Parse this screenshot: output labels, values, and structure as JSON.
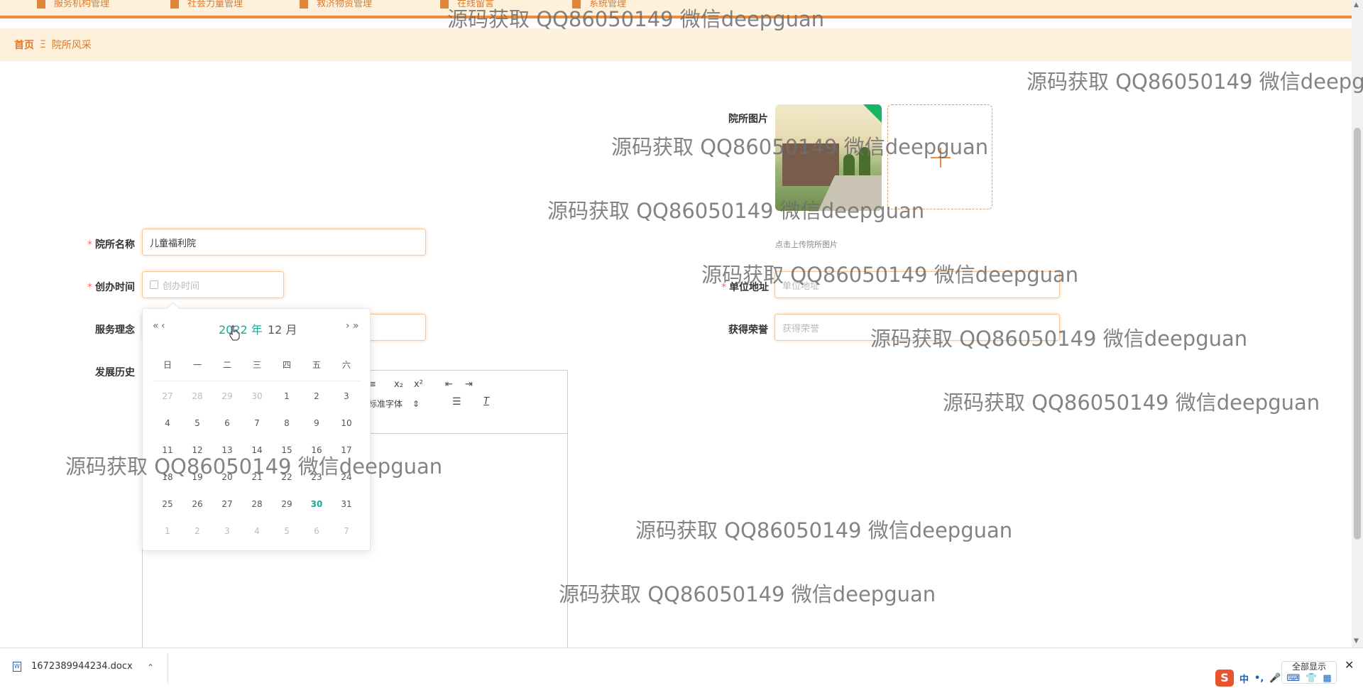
{
  "topnav": {
    "items": [
      "服务机构管理",
      "社会力量管理",
      "救济物资管理",
      "在线留言",
      "系统管理"
    ]
  },
  "breadcrumb": {
    "home": "首页",
    "separator": "Ξ",
    "current": "院所风采"
  },
  "form": {
    "name_label": "院所名称",
    "name_value": "儿童福利院",
    "founded_label": "创办时间",
    "founded_placeholder": "创办时间",
    "philosophy_label": "服务理念",
    "history_label": "发展历史",
    "image_label": "院所图片",
    "upload_hint": "点击上传院所图片",
    "address_label": "单位地址",
    "address_placeholder": "单位地址",
    "honors_label": "获得荣誉",
    "honors_placeholder": "获得荣誉",
    "required_mark": "*"
  },
  "editor": {
    "toolbar": [
      "≡",
      "x₂",
      "x²",
      "⇤",
      "⇥"
    ],
    "font_select": "标准字体",
    "align_icon": "align-center-icon",
    "clear_format_icon": "clear-format-icon"
  },
  "datepicker": {
    "prev_year": "«",
    "prev_month": "‹",
    "next_month": "›",
    "next_year": "»",
    "year": "2022 年",
    "month": "12 月",
    "weekdays": [
      "日",
      "一",
      "二",
      "三",
      "四",
      "五",
      "六"
    ],
    "weeks": [
      [
        "27",
        "28",
        "29",
        "30",
        "1",
        "2",
        "3"
      ],
      [
        "4",
        "5",
        "6",
        "7",
        "8",
        "9",
        "10"
      ],
      [
        "11",
        "12",
        "13",
        "14",
        "15",
        "16",
        "17"
      ],
      [
        "18",
        "19",
        "20",
        "21",
        "22",
        "23",
        "24"
      ],
      [
        "25",
        "26",
        "27",
        "28",
        "29",
        "30",
        "31"
      ],
      [
        "1",
        "2",
        "3",
        "4",
        "5",
        "6",
        "7"
      ]
    ],
    "today": "30"
  },
  "watermark": "源码获取 QQ86050149 微信deepguan",
  "download_bar": {
    "file_name": "1672389944234.docx",
    "show_all": "全部显示",
    "ime": [
      "中",
      "•,",
      "🎤",
      "⌨",
      "👕",
      "▦"
    ],
    "ime_logo": "S"
  },
  "colors": {
    "accent": "#ef8a3a",
    "bar_bg": "#fdf1dc",
    "today": "#18a999",
    "required": "#f56c6c"
  }
}
